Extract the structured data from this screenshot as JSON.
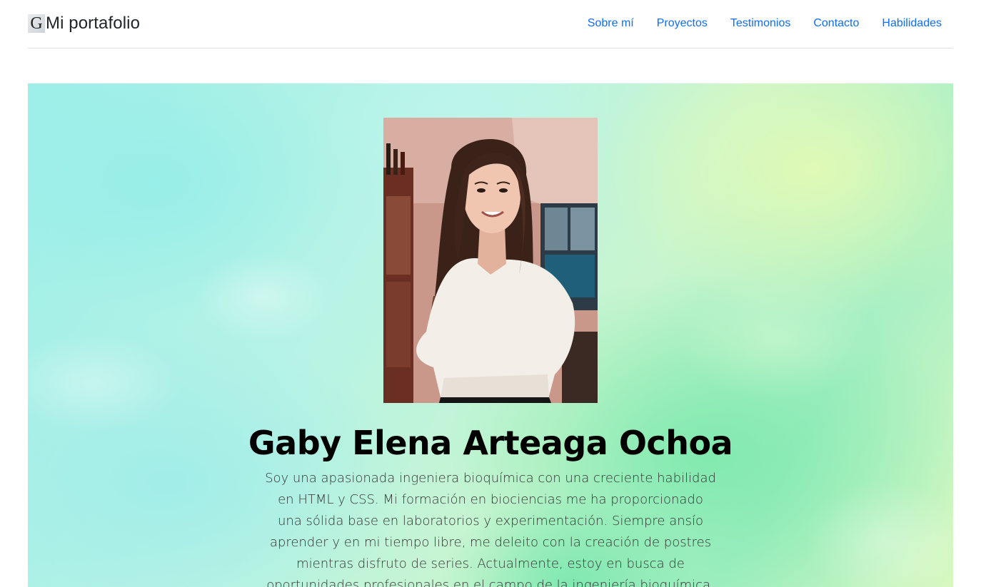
{
  "header": {
    "logo_letter": "G",
    "brand": "Mi portafolio",
    "nav": [
      {
        "label": "Sobre mí"
      },
      {
        "label": "Proyectos"
      },
      {
        "label": "Testimonios"
      },
      {
        "label": "Contacto"
      },
      {
        "label": "Habilidades"
      }
    ]
  },
  "hero": {
    "title": "Gaby Elena Arteaga Ochoa",
    "description": "Soy una apasionada ingeniera bioquímica con una creciente habilidad en HTML y CSS. Mi formación en biociencias me ha proporcionado una sólida base en laboratorios y experimentación. Siempre ansío aprender y en mi tiempo libre, me deleito con la creación de postres mientras disfruto de series. Actualmente, estoy en busca de oportunidades profesionales en el campo de la ingeniería bioquímica.",
    "colors": {
      "background_cyan": "#9deee8",
      "background_green": "#78e8aa",
      "background_lime": "#e2fab4"
    }
  },
  "colors": {
    "link": "#0d6efd",
    "text": "#212529",
    "divider": "#dee2e6"
  }
}
